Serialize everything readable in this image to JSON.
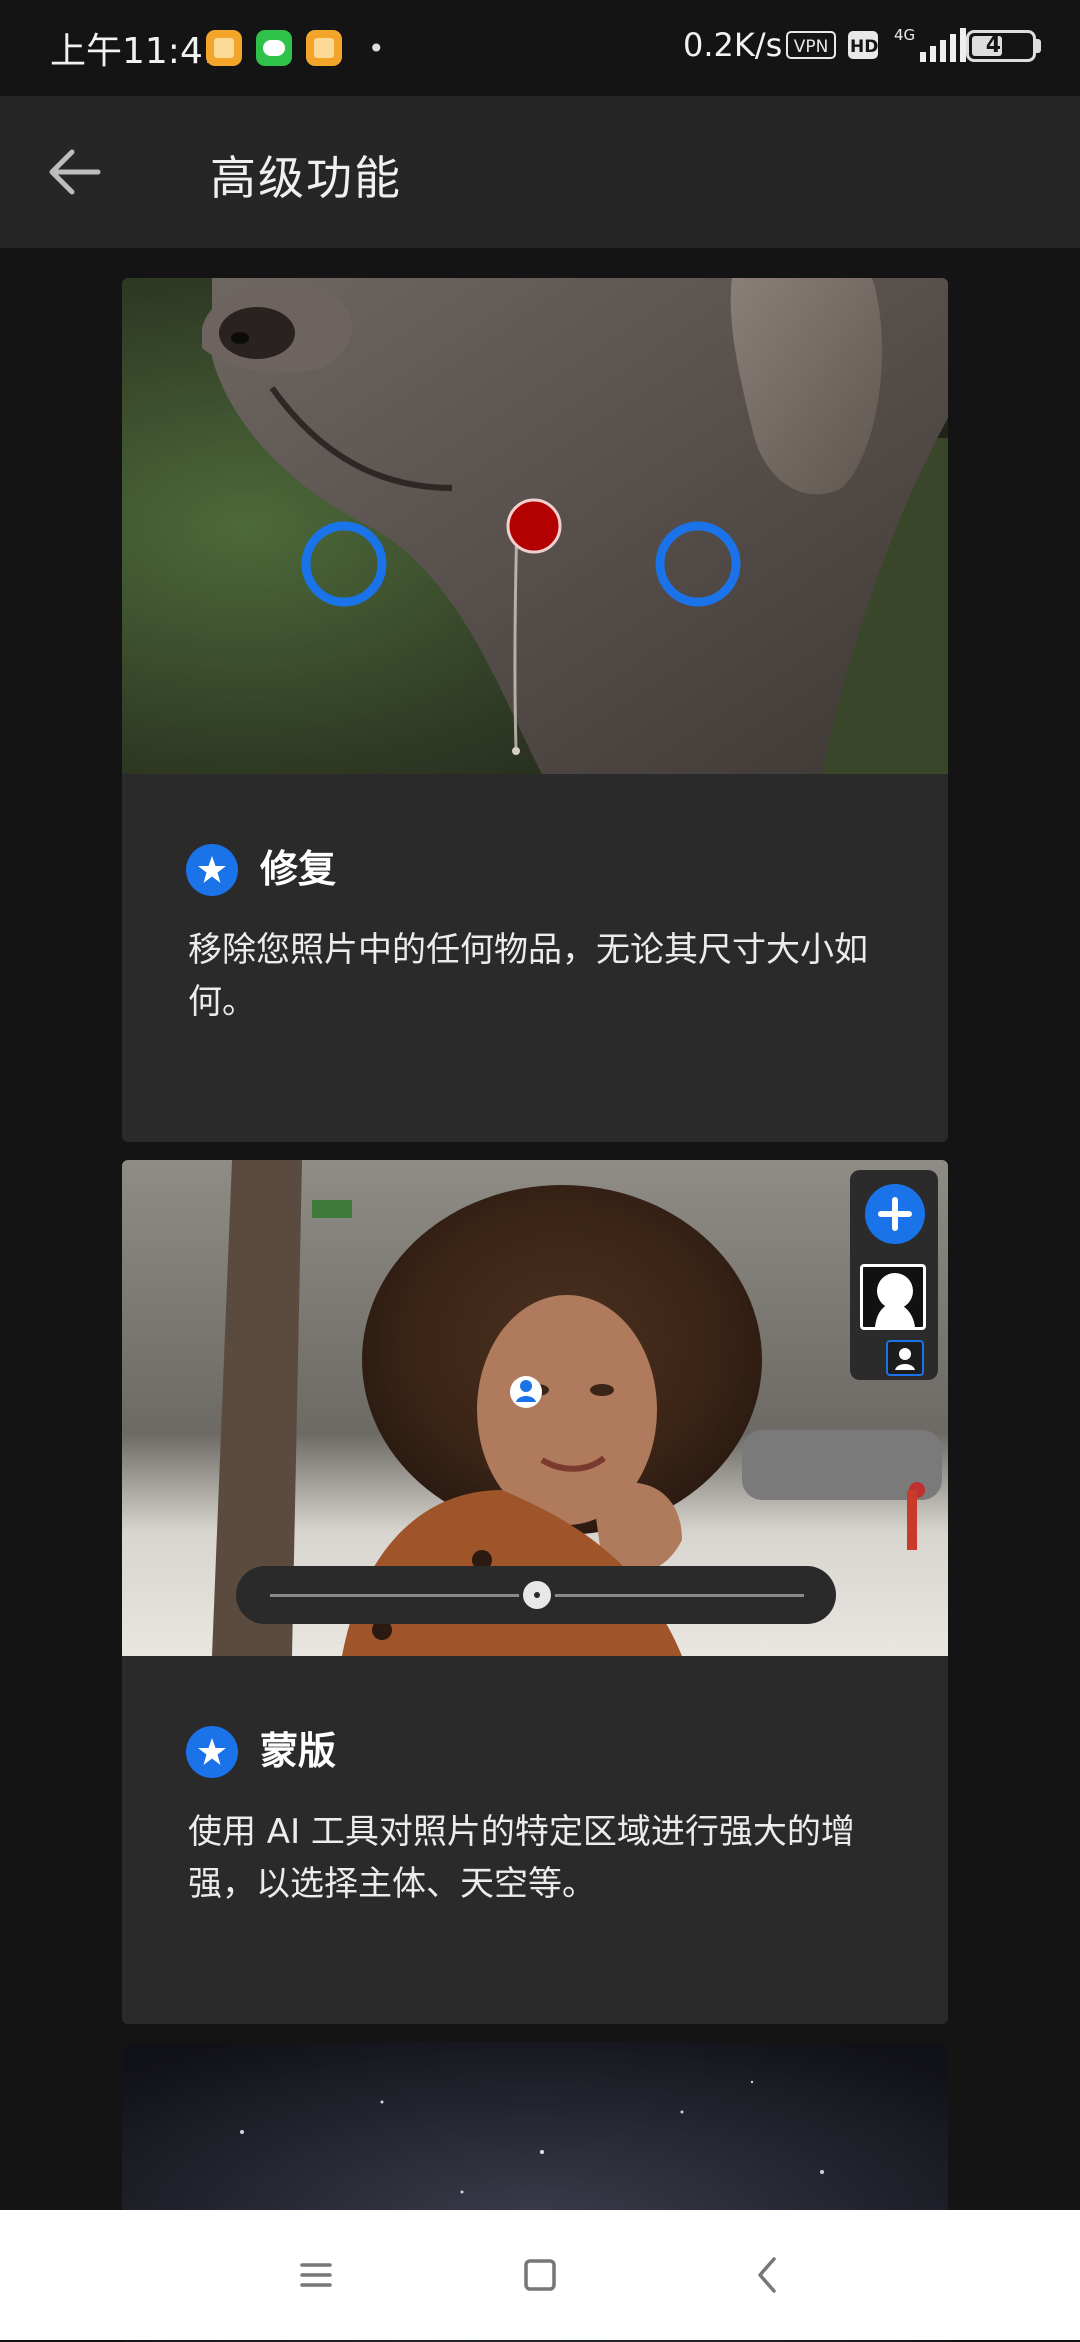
{
  "status_bar": {
    "time": "上午11:41",
    "net_speed": "0.2K/s",
    "vpn": "VPN",
    "hd": "HD",
    "network": "4G",
    "battery": "42"
  },
  "app_bar": {
    "title": "高级功能",
    "back_icon": "arrow-left-icon"
  },
  "features": [
    {
      "title": "修复",
      "description": "移除您照片中的任何物品，无论其尺寸大小如何。",
      "icon": "star-badge-icon"
    },
    {
      "title": "蒙版",
      "description": "使用 AI 工具对照片的特定区域进行强大的增强，以选择主体、天空等。",
      "icon": "star-badge-icon",
      "slider_value": 0.5
    }
  ],
  "colors": {
    "accent": "#1a73e8",
    "background": "#141414",
    "card": "#2a2a2b",
    "heal_marker": "#b30000"
  },
  "nav_bar": {
    "icons": [
      "menu-icon",
      "home-square-icon",
      "back-chevron-icon"
    ]
  }
}
